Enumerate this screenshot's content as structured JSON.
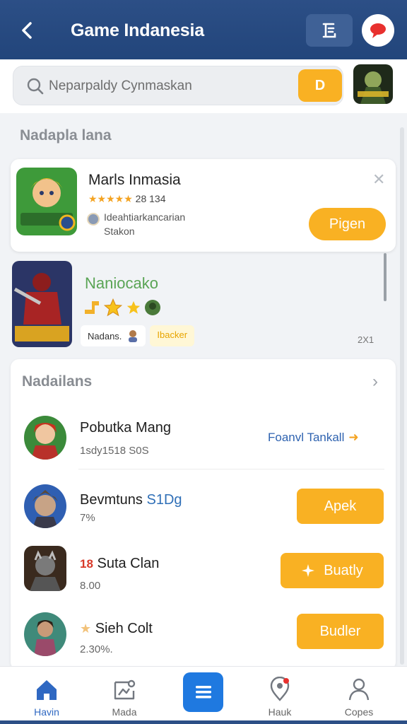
{
  "header": {
    "title": "Game Indanesia",
    "back_icon": "chevron-left-icon",
    "menu_icon": "document-icon",
    "chat_icon": "chat-bubble-icon"
  },
  "search": {
    "placeholder": "Neparpaldy Cynmaskan",
    "button_label": "D"
  },
  "section1": {
    "title": "Nadapla lana",
    "card": {
      "title": "Marls Inmasia",
      "stars": "★★★★★",
      "rating_text": "28 134",
      "developer_line1": "Ideahtiarkancarian",
      "developer_line2": "Stakon",
      "open_label": "Pigen"
    },
    "feature": {
      "title": "Naniocako",
      "tag1": "Nadans.",
      "tag2": "Ibacker",
      "count": "2X1"
    }
  },
  "section2": {
    "title": "Nadailans",
    "items": [
      {
        "name": "Pobutka Mang",
        "sub": "1sdy1518 S0S",
        "link": "Foanvl Tankall"
      },
      {
        "name": "Bevmtuns",
        "name_highlight": "S1Dg",
        "sub": "7%",
        "button": "Apek"
      },
      {
        "prefix": "18",
        "name": "Suta Clan",
        "sub": "8.00",
        "button": "Buatly"
      },
      {
        "prefix": "★",
        "name": "Sieh Colt",
        "sub": "2.30%.",
        "button": "Budler"
      }
    ]
  },
  "nav": {
    "items": [
      {
        "label": "Havin",
        "icon": "home-icon"
      },
      {
        "label": "Mada",
        "icon": "map-icon"
      },
      {
        "label": "",
        "icon": "menu-icon"
      },
      {
        "label": "Hauk",
        "icon": "location-pin-icon"
      },
      {
        "label": "Copes",
        "icon": "user-icon"
      }
    ]
  },
  "colors": {
    "header_bg": "#2c4f86",
    "accent_yellow": "#f9b123",
    "nav_active": "#2f68c2",
    "center_button": "#1f79e0"
  }
}
